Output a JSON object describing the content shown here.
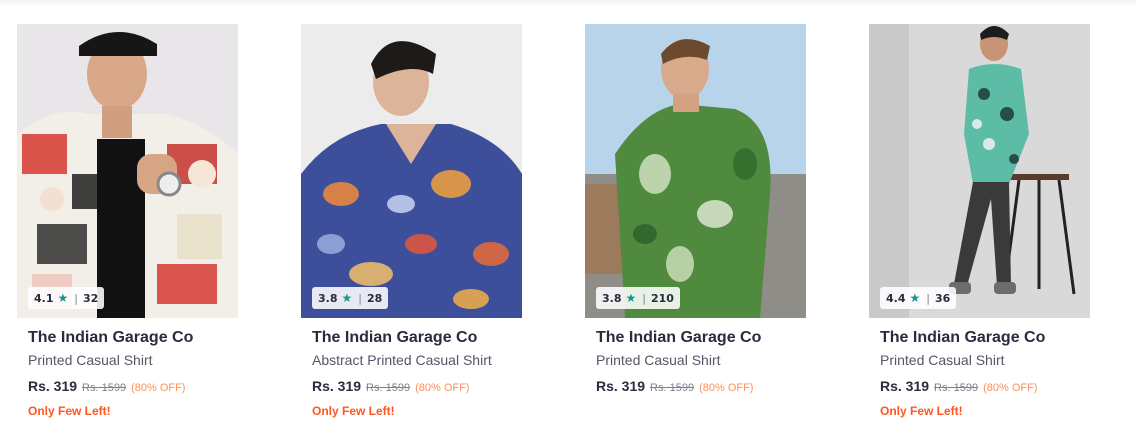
{
  "products": [
    {
      "rating": "4.1",
      "rating_count": "32",
      "brand": "The Indian Garage Co",
      "name": "Printed Casual Shirt",
      "price": "Rs. 319",
      "mrp": "Rs. 1599",
      "discount": "(80% OFF)",
      "stock_note": "Only Few Left!"
    },
    {
      "rating": "3.8",
      "rating_count": "28",
      "brand": "The Indian Garage Co",
      "name": "Abstract Printed Casual Shirt",
      "price": "Rs. 319",
      "mrp": "Rs. 1599",
      "discount": "(80% OFF)",
      "stock_note": "Only Few Left!"
    },
    {
      "rating": "3.8",
      "rating_count": "210",
      "brand": "The Indian Garage Co",
      "name": "Printed Casual Shirt",
      "price": "Rs. 319",
      "mrp": "Rs. 1599",
      "discount": "(80% OFF)",
      "stock_note": ""
    },
    {
      "rating": "4.4",
      "rating_count": "36",
      "brand": "The Indian Garage Co",
      "name": "Printed Casual Shirt",
      "price": "Rs. 319",
      "mrp": "Rs. 1599",
      "discount": "(80% OFF)",
      "stock_note": "Only Few Left!"
    }
  ],
  "icons": {
    "rating": "star-icon"
  },
  "colors": {
    "star": "#14958f",
    "discount": "#ff905a",
    "stock": "#ff5722",
    "text": "#282c3f"
  }
}
